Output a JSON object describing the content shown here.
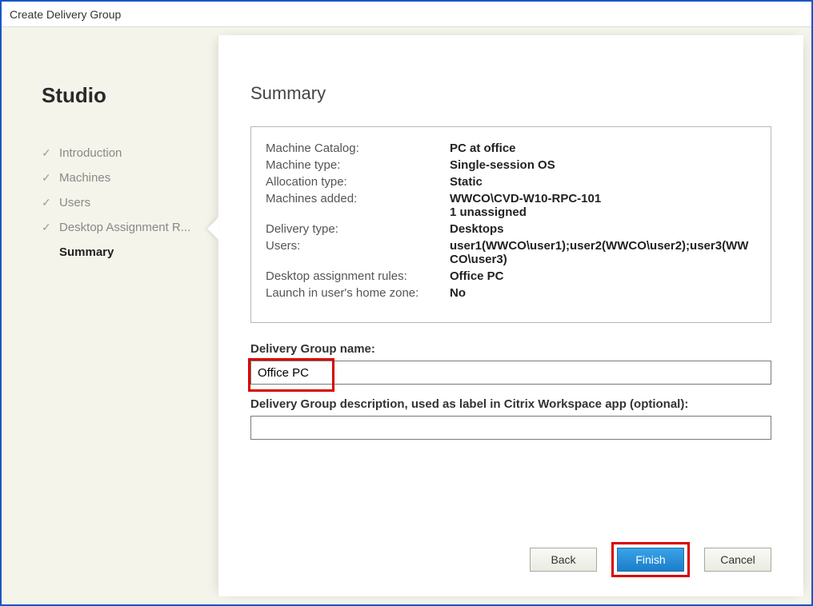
{
  "window": {
    "title": "Create Delivery Group"
  },
  "brand": "Studio",
  "nav": {
    "items": [
      {
        "label": "Introduction",
        "done": true
      },
      {
        "label": "Machines",
        "done": true
      },
      {
        "label": "Users",
        "done": true
      },
      {
        "label": "Desktop Assignment R...",
        "done": true
      },
      {
        "label": "Summary",
        "current": true
      }
    ]
  },
  "page": {
    "heading": "Summary"
  },
  "summary": {
    "rows": [
      {
        "label": "Machine Catalog:",
        "value": "PC at office"
      },
      {
        "label": "Machine type:",
        "value": "Single-session OS"
      },
      {
        "label": "Allocation type:",
        "value": "Static"
      },
      {
        "label": "Machines added:",
        "value": "WWCO\\CVD-W10-RPC-101\n1 unassigned"
      },
      {
        "label": "Delivery type:",
        "value": "Desktops"
      },
      {
        "label": "Users:",
        "value": "user1(WWCO\\user1);user2(WWCO\\user2);user3(WWCO\\user3)"
      },
      {
        "label": "Desktop assignment rules:",
        "value": "Office PC"
      },
      {
        "label": "Launch in user's home zone:",
        "value": "No"
      }
    ]
  },
  "fields": {
    "name_label": "Delivery Group name:",
    "name_value": "Office PC",
    "desc_label": "Delivery Group description, used as label in Citrix Workspace app (optional):",
    "desc_value": ""
  },
  "buttons": {
    "back": "Back",
    "finish": "Finish",
    "cancel": "Cancel"
  }
}
